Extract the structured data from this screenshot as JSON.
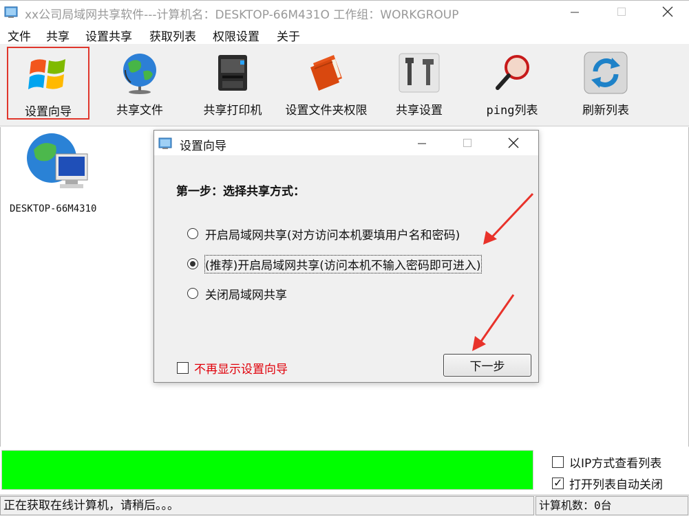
{
  "window": {
    "title": "xx公司局域网共享软件---计算机名：DESKTOP-66M431O  工作组：WORKGROUP"
  },
  "menu": [
    "文件",
    "共享",
    "设置共享",
    "获取列表",
    "权限设置",
    "关于"
  ],
  "toolbar": [
    {
      "label": "设置向导",
      "icon": "windows-logo-icon"
    },
    {
      "label": "共享文件",
      "icon": "globe-icon"
    },
    {
      "label": "共享打印机",
      "icon": "printer-icon"
    },
    {
      "label": "设置文件夹权限",
      "icon": "folder-permission-icon"
    },
    {
      "label": "共享设置",
      "icon": "tools-icon"
    },
    {
      "label": "ping列表",
      "icon": "magnifier-icon"
    },
    {
      "label": "刷新列表",
      "icon": "refresh-icon"
    }
  ],
  "computers": [
    {
      "name": "DESKTOP-66M4310"
    }
  ],
  "dialog": {
    "title": "设置向导",
    "heading": "第一步：选择共享方式：",
    "options": [
      {
        "label": "开启局域网共享(对方访问本机要填用户名和密码)",
        "checked": false
      },
      {
        "label": "(推荐)开启局域网共享(访问本机不输入密码即可进入)",
        "checked": true
      },
      {
        "label": "关闭局域网共享",
        "checked": false
      }
    ],
    "dont_show_label": "不再显示设置向导",
    "next_label": "下一步"
  },
  "options": [
    {
      "label": "以IP方式查看列表",
      "checked": false
    },
    {
      "label": "打开列表自动关闭",
      "checked": true
    }
  ],
  "status": {
    "message": "正在获取在线计算机，请稍后。。。",
    "count": "计算机数：0台"
  },
  "colors": {
    "accent_red": "#e0362c",
    "progress_green": "#00ff00",
    "warning_red": "#e0000a"
  }
}
